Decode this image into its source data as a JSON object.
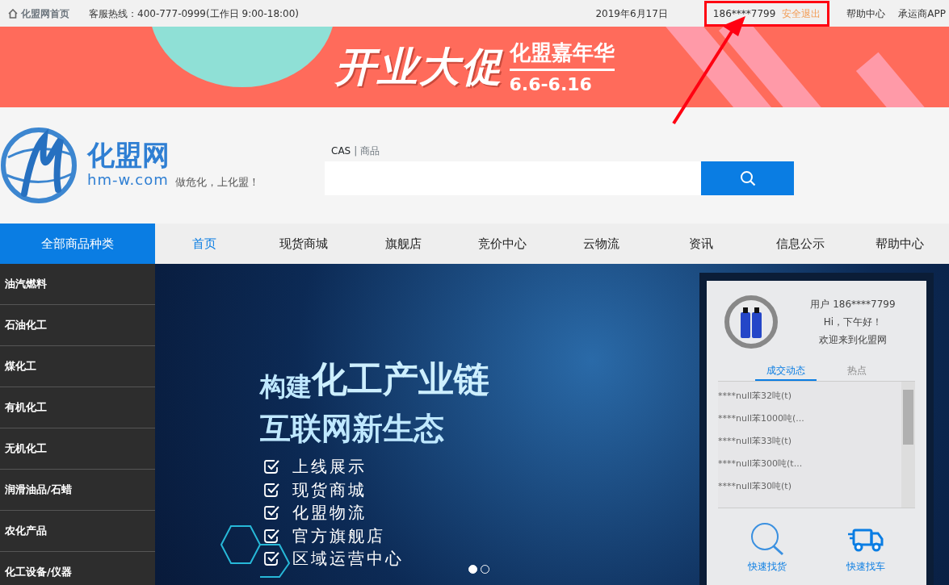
{
  "top_bar": {
    "home_link": "化盟网首页",
    "hotline": "客服热线：400-777-0999(工作日 9:00-18:00)",
    "date": "2019年6月17日",
    "user": "186****7799",
    "logout": "安全退出",
    "links": [
      "帮助中心",
      "承运商APP"
    ],
    "highlighted": true
  },
  "banner": {
    "headline": "开业大促",
    "subtitle": "化盟嘉年华",
    "dates": "6.6-6.16"
  },
  "header": {
    "logo_name": "化盟网",
    "logo_domain": "hm-w.com",
    "slogan": "做危化，上化盟！",
    "search_tab_divider": "|",
    "search_tabs": [
      {
        "label": "CAS",
        "selected": true
      },
      {
        "label": "商品",
        "selected": false
      }
    ]
  },
  "nav": {
    "category_button": "全部商品种类",
    "items": [
      {
        "label": "首页",
        "selected": true
      },
      {
        "label": "现货商城",
        "selected": false
      },
      {
        "label": "旗舰店",
        "selected": false
      },
      {
        "label": "竞价中心",
        "selected": false
      },
      {
        "label": "云物流",
        "selected": false
      },
      {
        "label": "资讯",
        "selected": false
      },
      {
        "label": "信息公示",
        "selected": false
      },
      {
        "label": "帮助中心",
        "selected": false
      }
    ]
  },
  "categories": [
    "油汽燃料",
    "石油化工",
    "煤化工",
    "有机化工",
    "无机化工",
    "润滑油品/石蜡",
    "农化产品",
    "化工设备/仪器"
  ],
  "hero": {
    "title_small": "构建",
    "title_big": "化工产业链",
    "title_line2": "互联网新生态",
    "features": [
      "上线展示",
      "现货商城",
      "化盟物流",
      "官方旗舰店",
      "区域运营中心"
    ],
    "slides": [
      {
        "selected": true
      },
      {
        "selected": false
      }
    ]
  },
  "user_panel": {
    "user": "用户 186****7799",
    "greeting": "Hi，下午好！",
    "welcome": "欢迎来到化盟网",
    "tabs": [
      {
        "label": "成交动态",
        "selected": true
      },
      {
        "label": "热点",
        "selected": false
      }
    ],
    "deals": [
      "****null苯32吨(t)",
      "****null苯1000吨(...",
      "****null苯33吨(t)",
      "****null苯300吨(t...",
      "****null苯30吨(t)"
    ],
    "quick_links": [
      {
        "kind": "goods",
        "label": "快速找货"
      },
      {
        "kind": "truck",
        "label": "快速找车"
      }
    ]
  }
}
